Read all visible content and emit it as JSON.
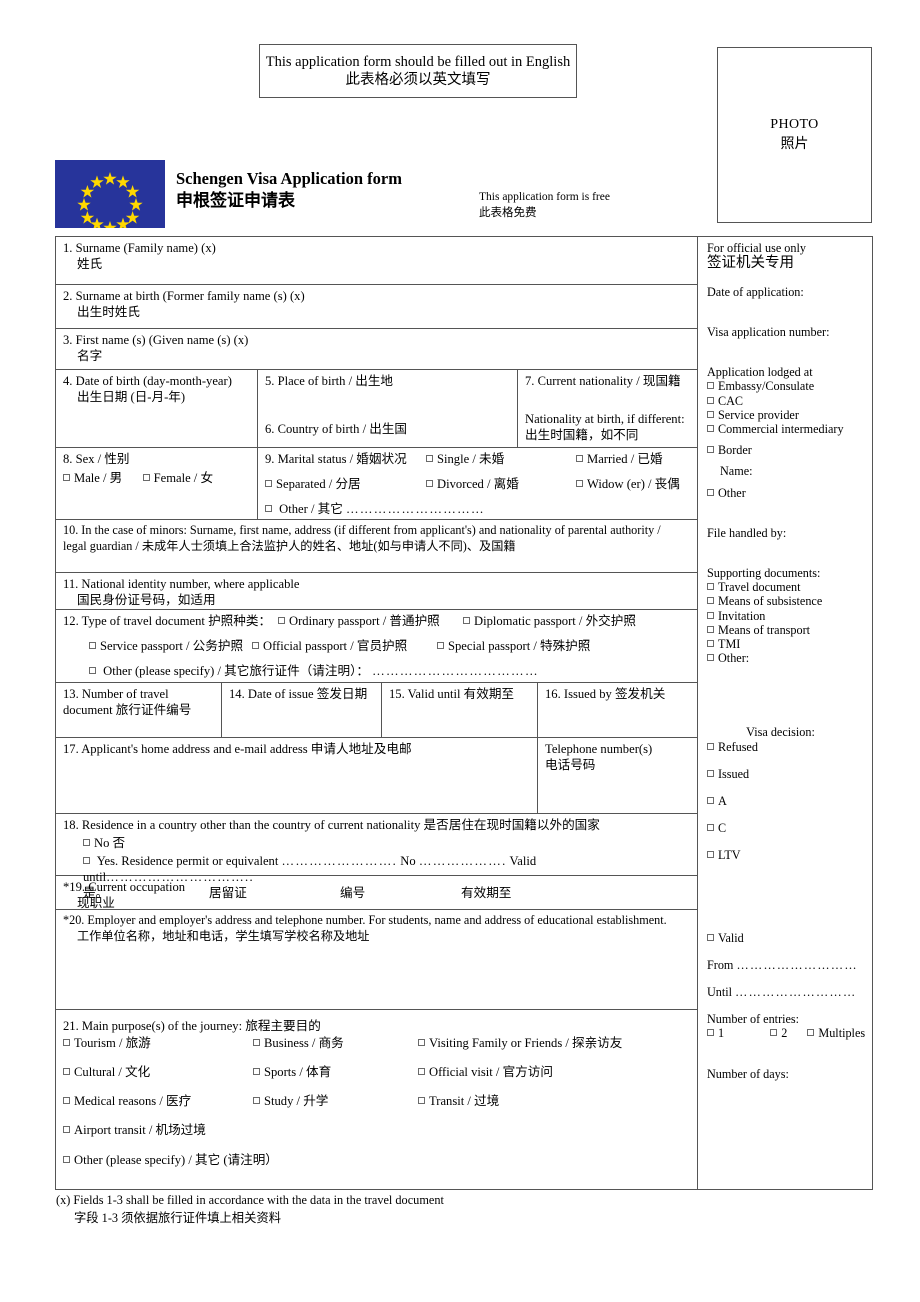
{
  "notice": {
    "english": "This application form should be filled out in English",
    "chinese": "此表格必须以英文填写"
  },
  "photo": {
    "english": "PHOTO",
    "chinese": "照片"
  },
  "header": {
    "title_en": "Schengen Visa Application form",
    "title_zh": "申根签证申请表",
    "free_en": "This application form is free",
    "free_zh": "此表格免费",
    "flag_color": "#27349b",
    "star_color": "#ffd800"
  },
  "fields": {
    "f1": {
      "en": "1. Surname (Family name) (x)",
      "zh": "姓氏"
    },
    "f2": {
      "en": "2. Surname at birth (Former family name (s) (x)",
      "zh": "出生时姓氏"
    },
    "f3": {
      "en": "3. First name (s) (Given name (s) (x)",
      "zh": "名字"
    },
    "f4": {
      "en": "4. Date of birth (day-month-year)",
      "zh": "出生日期 (日-月-年)"
    },
    "f5": {
      "en": "5. Place of birth / 出生地"
    },
    "f6": {
      "en": "6. Country of birth / 出生国"
    },
    "f7": {
      "en": "7. Current nationality / 现国籍",
      "sub_en": "Nationality at birth, if different:",
      "sub_zh": "出生时国籍，如不同"
    },
    "f8": {
      "en": "8. Sex / 性别",
      "options": [
        "Male / 男",
        "Female / 女"
      ]
    },
    "f9": {
      "en": "9. Marital status / 婚姻状况",
      "options": [
        "Single / 未婚",
        "Married / 已婚",
        "Separated / 分居",
        "Divorced / 离婚",
        "Widow (er) / 丧偶"
      ],
      "other": "Other / 其它",
      "other_dots": "…………………………"
    },
    "f10": {
      "line1": "10. In the case of minors: Surname, first name, address (if different from applicant's) and nationality of parental authority /",
      "line2": "legal guardian  /  未成年人士须填上合法监护人的姓名、地址(如与申请人不同)、及国籍"
    },
    "f11": {
      "en": "11. National identity number, where applicable",
      "zh": "国民身份证号码，如适用"
    },
    "f12": {
      "en": "12. Type of travel document 护照种类：",
      "row1": [
        "Ordinary passport / 普通护照",
        "Diplomatic passport / 外交护照"
      ],
      "row2": [
        "Service passport / 公务护照",
        "Official passport / 官员护照",
        "Special passport / 特殊护照"
      ],
      "other": "Other (please specify) / 其它旅行证件（请注明）：",
      "other_dots": "………………………………"
    },
    "f13": {
      "line1": "13. Number of travel",
      "line2": "document 旅行证件编号"
    },
    "f14": {
      "en": "14. Date of issue 签发日期"
    },
    "f15": {
      "en": "15. Valid until 有效期至"
    },
    "f16": {
      "en": "16. Issued by 签发机关"
    },
    "f17": {
      "en": "17. Applicant's home address and e-mail address 申请人地址及电邮",
      "tel_en": "Telephone number(s)",
      "tel_zh": "电话号码"
    },
    "f18": {
      "en": "18. Residence in a country other than the country of current nationality 是否居住在现时国籍以外的国家",
      "no": "No 否",
      "yes_a": "Yes. Residence permit or equivalent",
      "yes_dots_1": "…………………….",
      "yes_b": "No",
      "yes_dots_2": "……………….",
      "yes_c": "Valid until",
      "yes_dots_3": "…………………………..",
      "zh_1": "是。",
      "zh_2": "居留证",
      "zh_3": "编号",
      "zh_4": "有效期至"
    },
    "f19": {
      "en": "*19. Current occupation",
      "zh": "现职业"
    },
    "f20": {
      "en": "*20. Employer and employer's address and telephone number. For students, name and address of educational establishment.",
      "zh": "工作单位名称，地址和电话，学生填写学校名称及地址"
    },
    "f21": {
      "en": "21. Main purpose(s) of the journey: 旅程主要目的",
      "options": [
        "Tourism / 旅游",
        "Business / 商务",
        "Visiting Family or Friends / 探亲访友",
        "Cultural / 文化",
        "Sports / 体育",
        "Official visit / 官方访问",
        "Medical reasons / 医疗",
        "Study / 升学",
        "Transit / 过境",
        "Airport transit / 机场过境",
        "Other (please specify) / 其它 (请注明）"
      ]
    }
  },
  "official": {
    "title_en": "For official use only",
    "title_zh": "签证机关专用",
    "date_of_application": "Date of application:",
    "visa_application_number": "Visa application number:",
    "lodged_at_label": "Application lodged at",
    "lodged_at_options": [
      "Embassy/Consulate",
      "CAC",
      "Service provider",
      "Commercial intermediary"
    ],
    "border": "Border",
    "name": "Name:",
    "other": "Other",
    "file_handled_by": "File handled by:",
    "supporting_label": "Supporting documents:",
    "supporting_options": [
      "Travel document",
      "Means of subsistence",
      "Invitation",
      "Means of transport",
      "TMI",
      "Other:"
    ],
    "visa_decision": "Visa decision:",
    "decision_options": [
      "Refused",
      "Issued",
      "A",
      "C",
      "LTV"
    ],
    "valid": "Valid",
    "from_label": "From",
    "from_dots": "………………………",
    "until_label": "Until",
    "until_dots": "………………………",
    "entries_label": "Number of entries:",
    "entries_options": [
      "1",
      "2",
      "Multiples"
    ],
    "days_label": "Number of days:"
  },
  "footer": {
    "en": "(x) Fields 1-3 shall be filled in accordance with the data in the travel document",
    "zh": "字段 1-3 须依据旅行证件填上相关资料"
  }
}
